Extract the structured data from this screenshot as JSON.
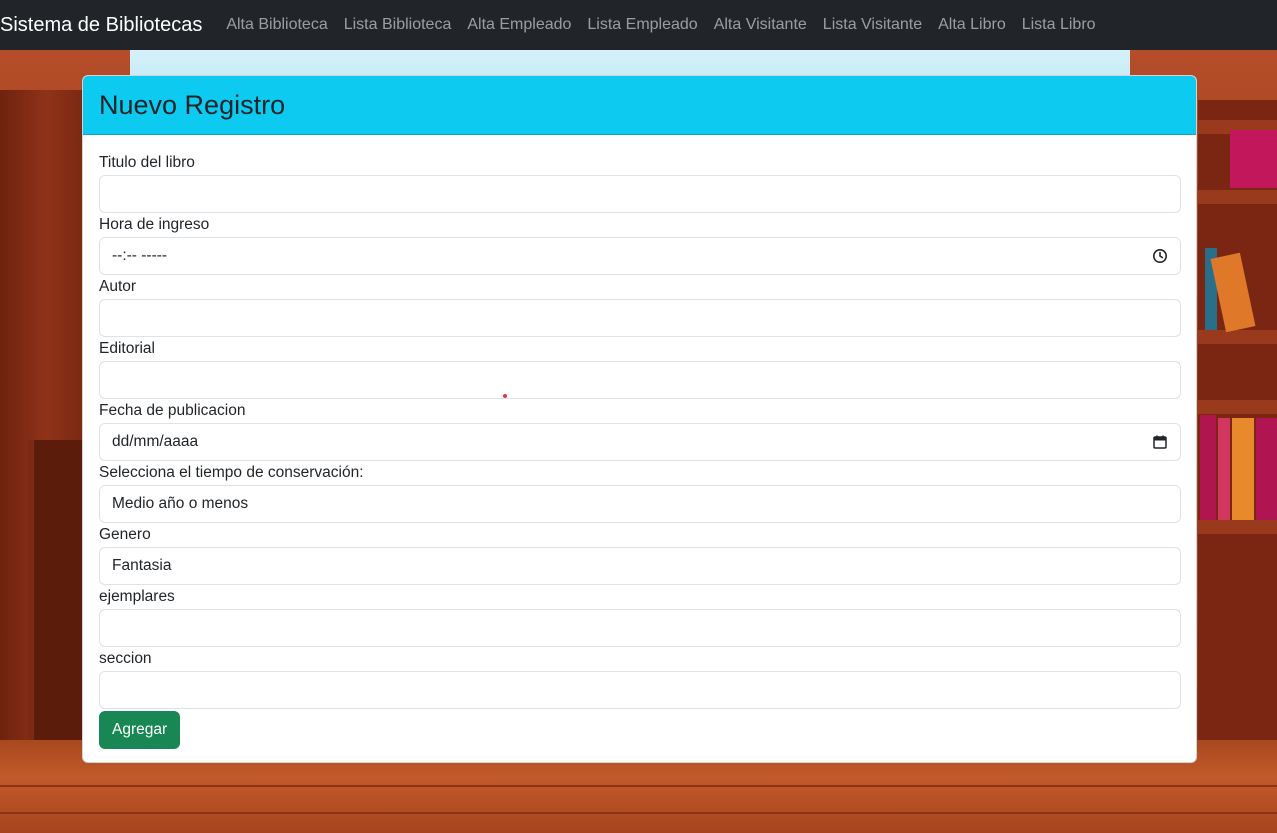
{
  "navbar": {
    "brand": "Sistema de Bibliotecas",
    "links": [
      {
        "label": "Alta Biblioteca"
      },
      {
        "label": "Lista Biblioteca"
      },
      {
        "label": "Alta Empleado"
      },
      {
        "label": "Lista Empleado"
      },
      {
        "label": "Alta Visitante"
      },
      {
        "label": "Lista Visitante"
      },
      {
        "label": "Alta Libro"
      },
      {
        "label": "Lista Libro"
      }
    ]
  },
  "card": {
    "title": "Nuevo Registro",
    "header_color": "#0dcaf0"
  },
  "form": {
    "titulo": {
      "label": "Titulo del libro",
      "value": ""
    },
    "hora": {
      "label": "Hora de ingreso",
      "value": "--:-- -----",
      "icon": "clock-icon"
    },
    "autor": {
      "label": "Autor",
      "value": ""
    },
    "editorial": {
      "label": "Editorial",
      "value": ""
    },
    "fecha": {
      "label": "Fecha de publicacion",
      "value": "dd/mm/aaaa",
      "icon": "calendar-icon"
    },
    "conservacion": {
      "label": "Selecciona el tiempo de conservación:",
      "value": "Medio año o menos"
    },
    "genero": {
      "label": "Genero",
      "value": "Fantasia"
    },
    "ejemplares": {
      "label": "ejemplares",
      "value": ""
    },
    "seccion": {
      "label": "seccion",
      "value": ""
    },
    "submit_label": "Agregar",
    "submit_color": "#198754"
  }
}
